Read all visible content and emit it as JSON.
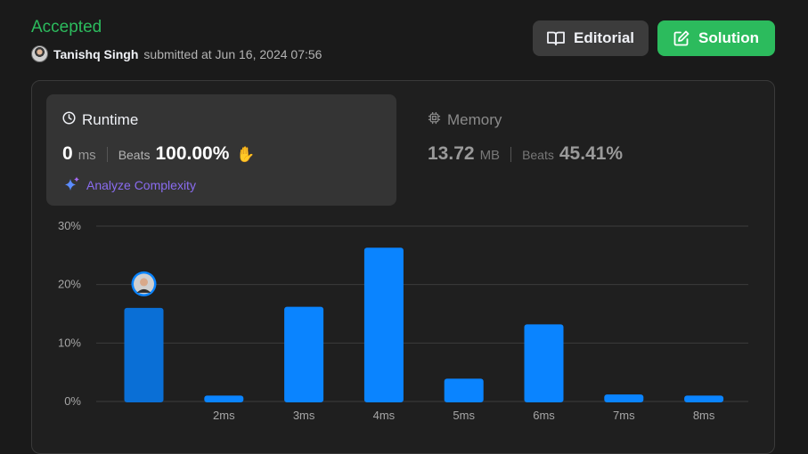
{
  "header": {
    "status": "Accepted",
    "username": "Tanishq Singh",
    "submitted_text": "submitted at Jun 16, 2024 07:56"
  },
  "actions": {
    "editorial_label": "Editorial",
    "solution_label": "Solution"
  },
  "runtime": {
    "title": "Runtime",
    "value": "0",
    "unit": "ms",
    "beats_label": "Beats",
    "beats_value": "100.00%",
    "analyze_label": "Analyze Complexity"
  },
  "memory": {
    "title": "Memory",
    "value": "13.72",
    "unit": "MB",
    "beats_label": "Beats",
    "beats_value": "45.41%"
  },
  "colors": {
    "accepted": "#2cbb5d",
    "bar": "#0a84ff",
    "bar_current": "#0a6fd6",
    "analyze": "#8a6cf0"
  },
  "chart_data": {
    "type": "bar",
    "categories": [
      "",
      "2ms",
      "3ms",
      "4ms",
      "5ms",
      "6ms",
      "7ms",
      "8ms"
    ],
    "values": [
      16,
      1,
      16.2,
      26.3,
      3.9,
      13.2,
      1.2,
      1
    ],
    "highlight_index": 0,
    "yticks": [
      "30%",
      "20%",
      "10%",
      "0%"
    ],
    "ylim": [
      0,
      30
    ],
    "grid": true
  }
}
